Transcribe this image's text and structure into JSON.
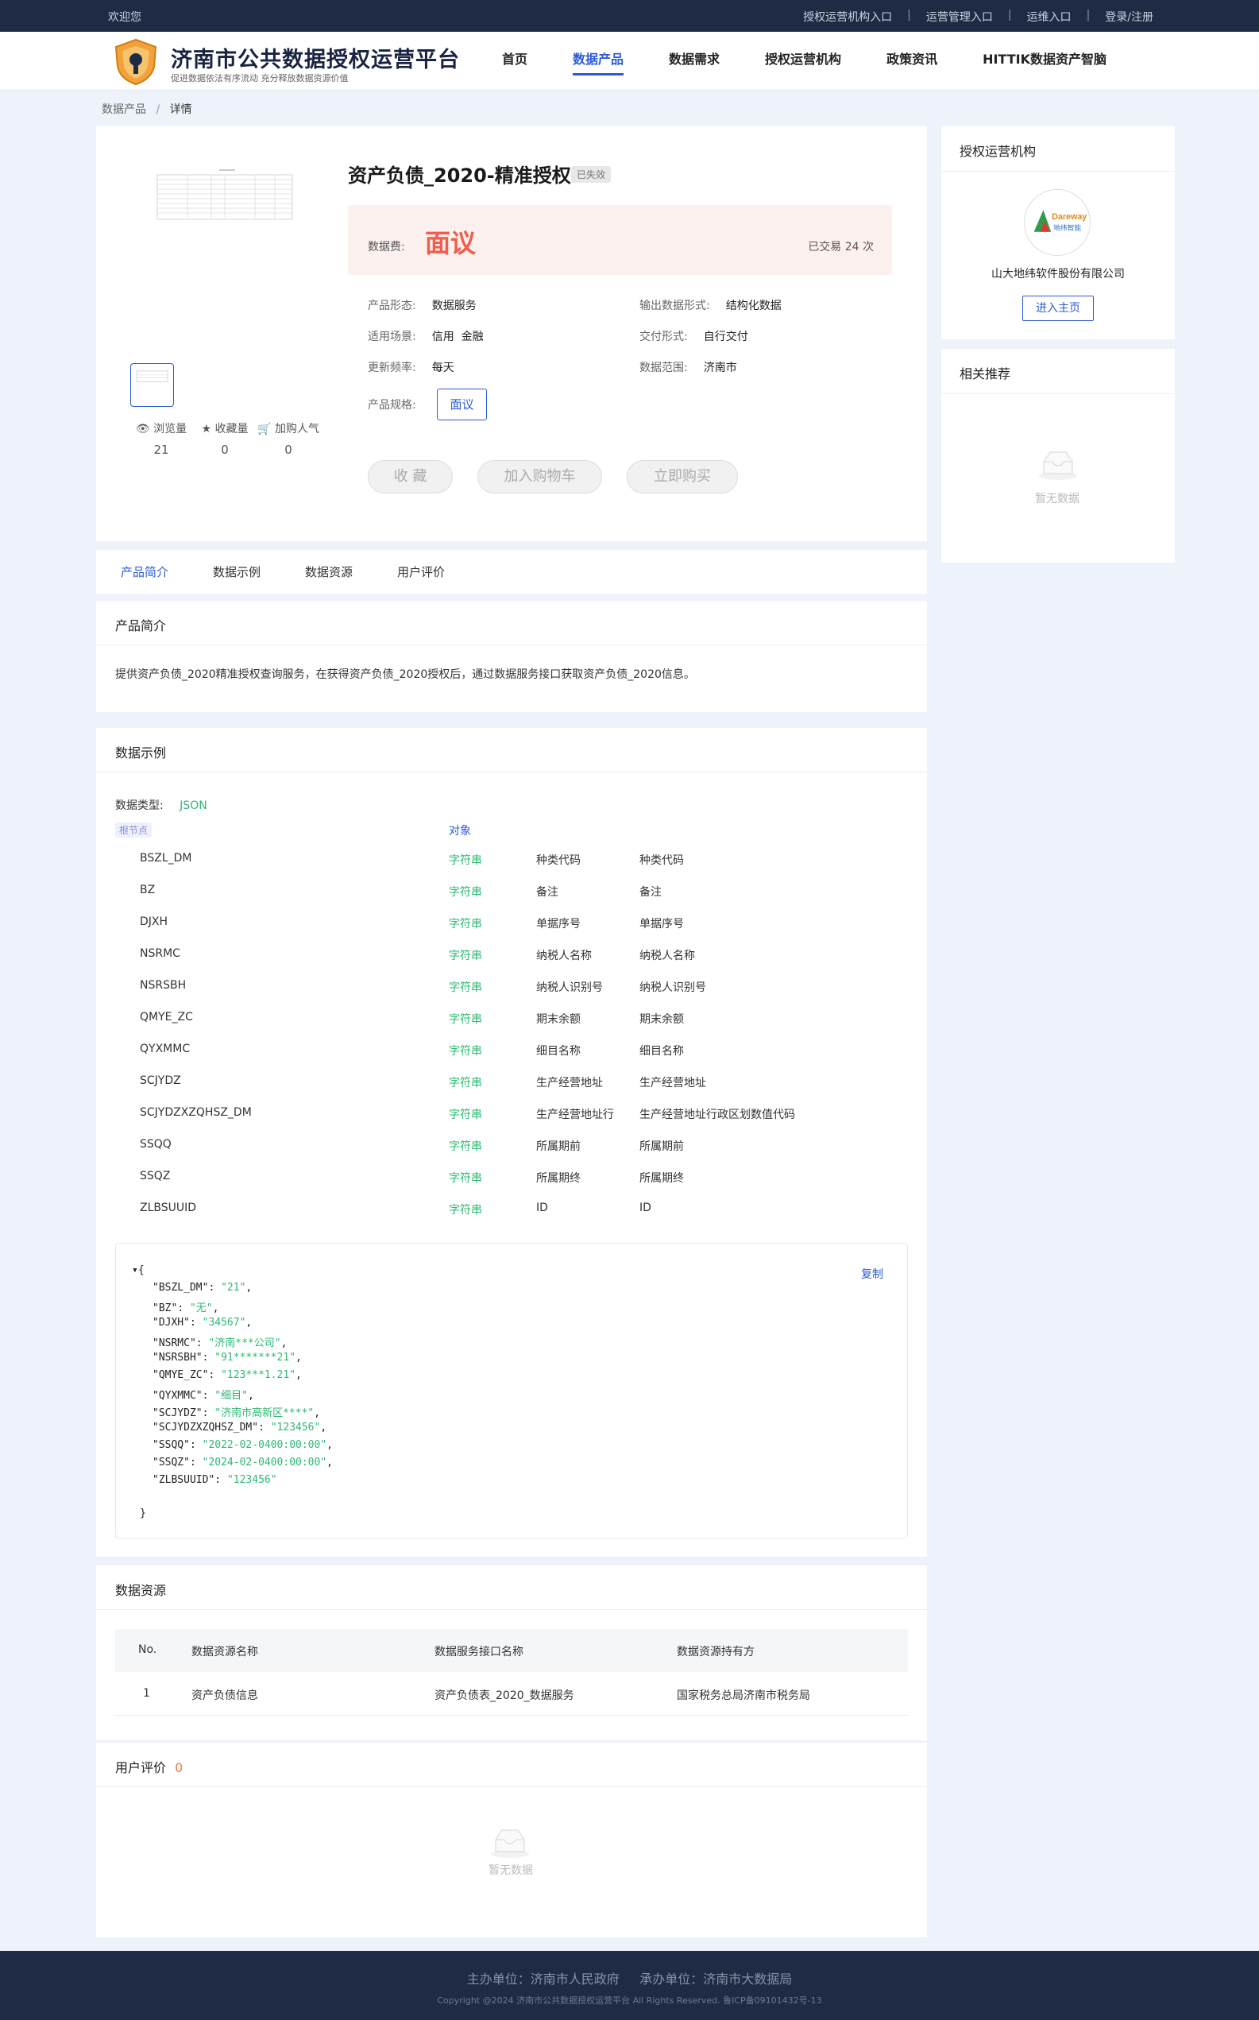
{
  "topbar": {
    "welcome": "欢迎您",
    "links": [
      "授权运营机构入口",
      "运营管理入口",
      "运维入口",
      "登录/注册"
    ]
  },
  "header": {
    "title": "济南市公共数据授权运营平台",
    "subtitle": "促进数据依法有序流动 充分释放数据资源价值",
    "nav": [
      "首页",
      "数据产品",
      "数据需求",
      "授权运营机构",
      "政策资讯",
      "HITTIK数据资产智脑"
    ],
    "active_nav": "数据产品"
  },
  "breadcrumb": {
    "parent": "数据产品",
    "sep": "/",
    "current": "详情"
  },
  "product": {
    "title": "资产负债_2020-精准授权",
    "status": "已失效",
    "price_label": "数据费:",
    "price": "面议",
    "traded": "已交易 24 次",
    "attrs": {
      "form_label": "产品形态:",
      "form": "数据服务",
      "output_label": "输出数据形式:",
      "output": "结构化数据",
      "scene_label": "适用场景:",
      "scene": "信用  金融",
      "delivery_label": "交付形式:",
      "delivery": "自行交付",
      "freq_label": "更新频率:",
      "freq": "每天",
      "range_label": "数据范围:",
      "range": "济南市",
      "spec_label": "产品规格:",
      "spec": "面议"
    },
    "stats": [
      {
        "label": "浏览量",
        "value": "21"
      },
      {
        "label": "收藏量",
        "value": "0"
      },
      {
        "label": "加购人气",
        "value": "0"
      }
    ],
    "buttons": {
      "fav": "收 藏",
      "cart": "加入购物车",
      "buy": "立即购买"
    }
  },
  "side": {
    "org_title": "授权运营机构",
    "org_logo_text": "Dareway",
    "org_logo_sub": "地纬智能",
    "org_name": "山大地纬软件股份有限公司",
    "org_btn": "进入主页",
    "rec_title": "相关推荐",
    "rec_empty": "暂无数据"
  },
  "tabs": [
    "产品简介",
    "数据示例",
    "数据资源",
    "用户评价"
  ],
  "intro": {
    "title": "产品简介",
    "text": "提供资产负债_2020精准授权查询服务，在获得资产负债_2020授权后，通过数据服务接口获取资产负债_2020信息。"
  },
  "sample": {
    "title": "数据示例",
    "type_label": "数据类型:",
    "type": "JSON",
    "root_label": "根节点",
    "root_type": "对象",
    "fields": [
      {
        "name": "BSZL_DM",
        "type": "字符串",
        "cn": "种类代码",
        "desc": "种类代码"
      },
      {
        "name": "BZ",
        "type": "字符串",
        "cn": "备注",
        "desc": "备注"
      },
      {
        "name": "DJXH",
        "type": "字符串",
        "cn": "单据序号",
        "desc": "单据序号"
      },
      {
        "name": "NSRMC",
        "type": "字符串",
        "cn": "纳税人名称",
        "desc": "纳税人名称"
      },
      {
        "name": "NSRSBH",
        "type": "字符串",
        "cn": "纳税人识别号",
        "desc": "纳税人识别号"
      },
      {
        "name": "QMYE_ZC",
        "type": "字符串",
        "cn": "期末余额",
        "desc": "期末余额"
      },
      {
        "name": "QYXMMC",
        "type": "字符串",
        "cn": "细目名称",
        "desc": "细目名称"
      },
      {
        "name": "SCJYDZ",
        "type": "字符串",
        "cn": "生产经营地址",
        "desc": "生产经营地址"
      },
      {
        "name": "SCJYDZXZQHSZ_DM",
        "type": "字符串",
        "cn": "生产经营地址行",
        "desc": "生产经营地址行政区划数值代码"
      },
      {
        "name": "SSQQ",
        "type": "字符串",
        "cn": "所属期前",
        "desc": "所属期前"
      },
      {
        "name": "SSQZ",
        "type": "字符串",
        "cn": "所属期终",
        "desc": "所属期终"
      },
      {
        "name": "ZLBSUUID",
        "type": "字符串",
        "cn": "ID",
        "desc": "ID"
      }
    ],
    "copy": "复制",
    "json_open": "{",
    "json_close": "}",
    "json_pairs": [
      {
        "k": "\"BSZL_DM\"",
        "v": "\"21\""
      },
      {
        "k": "\"BZ\"",
        "v": "\"无\""
      },
      {
        "k": "\"DJXH\"",
        "v": "\"34567\""
      },
      {
        "k": "\"NSRMC\"",
        "v": "\"济南***公司\""
      },
      {
        "k": "\"NSRSBH\"",
        "v": "\"91*******21\""
      },
      {
        "k": "\"QMYE_ZC\"",
        "v": "\"123***1.21\""
      },
      {
        "k": "\"QYXMMC\"",
        "v": "\"细目\""
      },
      {
        "k": "\"SCJYDZ\"",
        "v": "\"济南市高新区****\""
      },
      {
        "k": "\"SCJYDZXZQHSZ_DM\"",
        "v": "\"123456\""
      },
      {
        "k": "\"SSQQ\"",
        "v": "\"2022-02-0400:00:00\""
      },
      {
        "k": "\"SSQZ\"",
        "v": "\"2024-02-0400:00:00\""
      },
      {
        "k": "\"ZLBSUUID\"",
        "v": "\"123456\""
      }
    ]
  },
  "resources": {
    "title": "数据资源",
    "headers": [
      "No.",
      "数据资源名称",
      "数据服务接口名称",
      "数据资源持有方"
    ],
    "rows": [
      [
        "1",
        "资产负债信息",
        "资产负债表_2020_数据服务",
        "国家税务总局济南市税务局"
      ]
    ]
  },
  "reviews": {
    "title": "用户评价",
    "count": "0",
    "empty": "暂无数据"
  },
  "footer": {
    "line1": "主办单位：济南市人民政府     承办单位：济南市大数据局",
    "line2": "Copyright @2024 济南市公共数据授权运营平台 All Rights Reserved. 鲁ICP备09101432号-13"
  },
  "colors": {
    "primary": "#2b5bd7",
    "price": "#f25c4b",
    "green": "#2eb872",
    "dark": "#1f2b45"
  }
}
